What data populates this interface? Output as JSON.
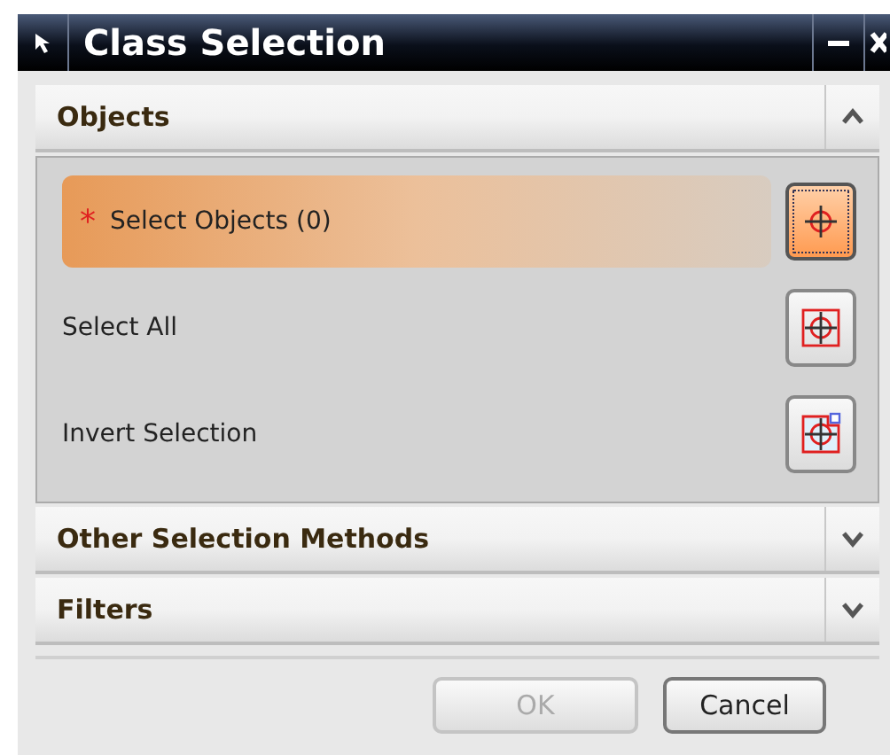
{
  "window": {
    "title": "Class Selection"
  },
  "sections": [
    {
      "title": "Objects",
      "expanded": true,
      "rows": [
        {
          "label": "Select Objects (0)",
          "mark": "*",
          "selected": true,
          "kind": "crosshair"
        },
        {
          "label": "Select All",
          "selected": false,
          "kind": "crosshair-box"
        },
        {
          "label": "Invert Selection",
          "selected": false,
          "kind": "crosshair-box-plus"
        }
      ]
    },
    {
      "title": "Other Selection Methods",
      "expanded": false
    },
    {
      "title": "Filters",
      "expanded": false
    }
  ],
  "buttons": [
    {
      "label": "OK",
      "disabled": true
    },
    {
      "label": "Cancel",
      "disabled": false
    }
  ]
}
